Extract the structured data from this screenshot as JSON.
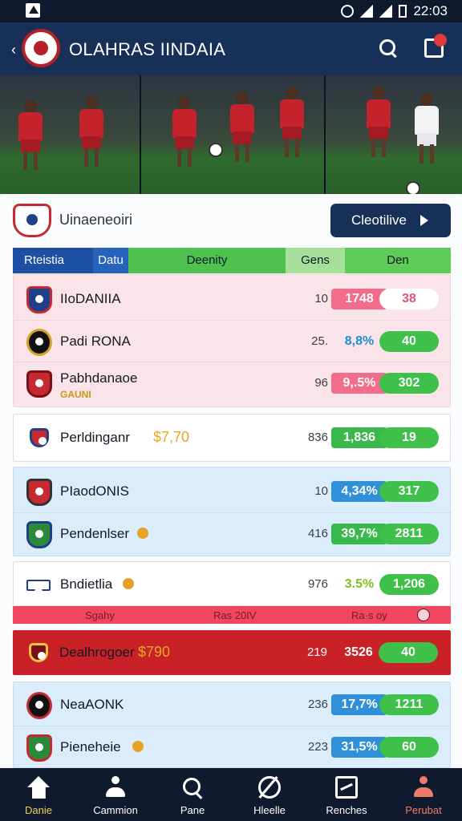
{
  "status_bar": {
    "time": "22:03"
  },
  "header": {
    "title": "OLAHRAS IINDAIA"
  },
  "hero": {
    "panels": 3
  },
  "league": {
    "name": "Uinaeneoiri"
  },
  "cta": {
    "label": "Cleotilive"
  },
  "table_header": {
    "col1": "Rteistia",
    "col2": "Datu",
    "col3": "Deenity",
    "col4": "Gens",
    "col5": "Den"
  },
  "groups": [
    {
      "rows": [
        {
          "team": "IIoDANIIA",
          "num": "10",
          "pct": "1748",
          "odd": "38"
        },
        {
          "team": "Padi RONA",
          "num": "25.",
          "pct": "8,8%",
          "odd": "40"
        },
        {
          "team": "Pabhdanaoe",
          "sub": "GAUNI",
          "num": "96",
          "pct": "9,.5%",
          "odd": "302"
        }
      ]
    },
    {
      "rows": [
        {
          "team": "Perldinganr",
          "price": "$7,70",
          "num": "836",
          "pct": "1,836",
          "odd": "19"
        }
      ]
    },
    {
      "rows": [
        {
          "team": "PIaodONIS",
          "num": "10",
          "pct": "4,34%",
          "odd": "317"
        },
        {
          "team": "Pendenlser",
          "num": "416",
          "pct": "39,7%",
          "odd": "2811"
        }
      ]
    },
    {
      "rows": [
        {
          "team": "Bndietlia",
          "num": "976",
          "pct": "3.5%",
          "odd": "1,206"
        }
      ]
    },
    {
      "rows": [
        {
          "team": "Dealhrogoer",
          "price": "$790",
          "num": "219",
          "pct": "3526",
          "odd": "40"
        }
      ]
    },
    {
      "rows": [
        {
          "team": "NeaAONK",
          "num": "236",
          "pct": "17,7%",
          "odd": "1211"
        },
        {
          "team": "Pieneheie",
          "num": "223",
          "pct": "31,5%",
          "odd": "60"
        }
      ]
    }
  ],
  "strip": {
    "a": "Sgahy",
    "b": "Ras 20IV",
    "c": "Ra·s oy"
  },
  "nav": [
    {
      "label": "Danie"
    },
    {
      "label": "Cammion"
    },
    {
      "label": "Pane"
    },
    {
      "label": "Hleelle"
    },
    {
      "label": "Renches"
    },
    {
      "label": "Perubat"
    }
  ],
  "colors": {
    "navy": "#173058",
    "red": "#c82127",
    "green": "#3fc04a",
    "blue": "#2f8fd8",
    "pink": "#f26c8c"
  }
}
